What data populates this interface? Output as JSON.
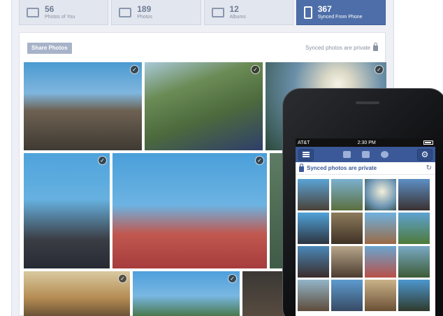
{
  "tabs": [
    {
      "count": "56",
      "label": "Photos of You",
      "icon": "photo-icon",
      "active": false
    },
    {
      "count": "189",
      "label": "Photos",
      "icon": "photo-icon",
      "active": false
    },
    {
      "count": "12",
      "label": "Albums",
      "icon": "album-icon",
      "active": false
    },
    {
      "count": "367",
      "label": "Synced From Phone",
      "icon": "phone-icon",
      "active": true
    }
  ],
  "toolbar": {
    "share_label": "Share Photos",
    "private_note": "Synced photos are private"
  },
  "phone": {
    "carrier": "AT&T",
    "time": "2:30 PM",
    "privacy_text": "Synced photos are private"
  },
  "colors": {
    "accent": "#4d6ea8",
    "facebook_blue": "#3b5998"
  }
}
